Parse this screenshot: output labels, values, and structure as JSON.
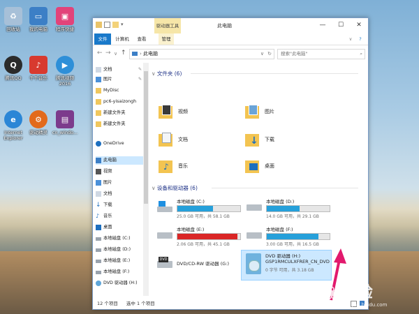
{
  "desktop": {
    "icons": [
      {
        "label": "回收站",
        "icon": "recycle-bin-icon",
        "color": "#9fb8d1"
      },
      {
        "label": "我的电脑",
        "icon": "computer-icon",
        "color": "#3c7fc6"
      },
      {
        "label": "程序快捷",
        "icon": "app-shortcut-icon",
        "color": "#e2437a"
      },
      {
        "label": "腾讯QQ",
        "icon": "qq-icon",
        "color": "#2b2b2b"
      },
      {
        "label": "千千音乐",
        "icon": "music-player-icon",
        "color": "#d83a2f"
      },
      {
        "label": "腾讯视频 2016",
        "icon": "video-app-icon",
        "color": "#2e8fd8"
      },
      {
        "label": "Internet Explorer",
        "icon": "ie-icon",
        "color": "#2b86d6"
      },
      {
        "label": "驱动精灵",
        "icon": "driver-app-icon",
        "color": "#e26a1c"
      },
      {
        "label": "cn_windo...",
        "icon": "winrar-icon",
        "color": "#7c3b8c"
      }
    ]
  },
  "window": {
    "title": "此电脑",
    "context_tab_group": "驱动器工具",
    "tabs": [
      "文件",
      "计算机",
      "查看",
      "管理"
    ],
    "controls": {
      "minimize": "—",
      "maximize": "☐",
      "close": "✕",
      "help": "?",
      "collapse": "∨"
    },
    "address": {
      "path": "此电脑",
      "refresh": "↻"
    },
    "search": {
      "placeholder": "搜索\"此电脑\""
    },
    "nav_buttons": [
      "←",
      "→",
      "∨",
      "↑"
    ],
    "sidebar": {
      "items": [
        {
          "label": "文档",
          "icon": "documents-icon",
          "pinned": true
        },
        {
          "label": "图片",
          "icon": "pictures-icon",
          "pinned": true
        },
        {
          "label": "MyDisc",
          "icon": "folder-icon",
          "pinned": false
        },
        {
          "label": "pc6-yisaizongh",
          "icon": "folder-icon",
          "pinned": false
        },
        {
          "label": "新建文件夹",
          "icon": "folder-icon",
          "pinned": false
        },
        {
          "label": "新建文件夹",
          "icon": "folder-icon",
          "pinned": false
        },
        {
          "label": "OneDrive",
          "icon": "onedrive-icon",
          "pinned": false
        },
        {
          "label": "此电脑",
          "icon": "computer-icon",
          "pinned": false,
          "selected": true
        },
        {
          "label": "视频",
          "icon": "videos-icon",
          "pinned": false
        },
        {
          "label": "图片",
          "icon": "pictures-icon",
          "pinned": false
        },
        {
          "label": "文档",
          "icon": "documents-icon",
          "pinned": false
        },
        {
          "label": "下载",
          "icon": "downloads-icon",
          "pinned": false
        },
        {
          "label": "音乐",
          "icon": "music-icon",
          "pinned": false
        },
        {
          "label": "桌面",
          "icon": "desktop-icon",
          "pinned": false
        },
        {
          "label": "本地磁盘 (C:)",
          "icon": "drive-icon",
          "pinned": false
        },
        {
          "label": "本地磁盘 (D:)",
          "icon": "drive-icon",
          "pinned": false
        },
        {
          "label": "本地磁盘 (E:)",
          "icon": "drive-icon",
          "pinned": false
        },
        {
          "label": "本地磁盘 (F:)",
          "icon": "drive-icon",
          "pinned": false
        },
        {
          "label": "DVD 驱动器 (H:)",
          "icon": "dvd-icon",
          "pinned": false
        }
      ]
    },
    "folders_group": {
      "title": "文件夹 (6)",
      "items": [
        {
          "label": "视频",
          "icon": "videos-folder-icon"
        },
        {
          "label": "图片",
          "icon": "pictures-folder-icon"
        },
        {
          "label": "文档",
          "icon": "documents-folder-icon"
        },
        {
          "label": "下载",
          "icon": "downloads-folder-icon"
        },
        {
          "label": "音乐",
          "icon": "music-folder-icon"
        },
        {
          "label": "桌面",
          "icon": "desktop-folder-icon"
        }
      ]
    },
    "drives_group": {
      "title": "设备和驱动器 (6)",
      "items": [
        {
          "name": "本地磁盘 (C:)",
          "size": "25.0 GB 可用，共 58.1 GB",
          "used": 0.57,
          "bar_color": "#26a0da",
          "icon": "windows-drive-icon"
        },
        {
          "name": "本地磁盘 (D:)",
          "size": "14.0 GB 可用，共 29.1 GB",
          "used": 0.52,
          "bar_color": "#26a0da",
          "icon": "drive-icon"
        },
        {
          "name": "本地磁盘 (E:)",
          "size": "2.06 GB 可用，共 45.1 GB",
          "used": 0.95,
          "bar_color": "#da2626",
          "icon": "drive-icon"
        },
        {
          "name": "本地磁盘 (F:)",
          "size": "3.00 GB 可用，共 16.5 GB",
          "used": 0.82,
          "bar_color": "#26a0da",
          "icon": "drive-icon"
        },
        {
          "name": "DVD/CD-RW 驱动器 (G:)",
          "icon": "dvd-rw-icon"
        },
        {
          "name": "DVD 驱动器 (H:)",
          "volume": "GSP1RMCULXFRER_CN_DVD",
          "size": "0 字节 可用，共 3.18 GB",
          "icon": "dvd-disc-icon",
          "selected": true
        }
      ]
    },
    "status": {
      "count": "12 个项目",
      "selection": "选中 1 个项目"
    }
  },
  "watermark": {
    "text": "经验",
    "sub": "jingyan.baidu.com"
  },
  "accent": "#1979ca"
}
